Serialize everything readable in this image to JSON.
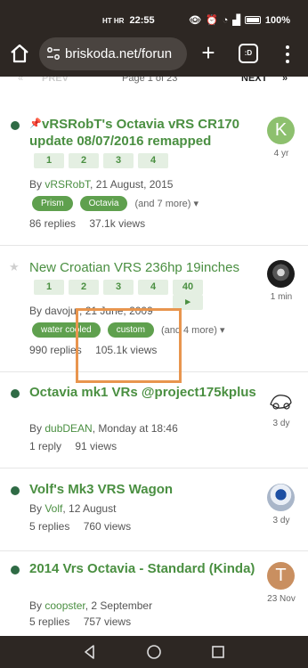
{
  "status_bar": {
    "network": "HT HR",
    "time": "22:55",
    "battery": "100%"
  },
  "browser": {
    "url": "briskoda.net/forun",
    "tabs_count": ":D"
  },
  "pagination": {
    "first": "«",
    "prev": "PREV",
    "page_label": "Page 1 of 23",
    "next": "NEXT",
    "last": "»"
  },
  "threads": [
    {
      "title": "vRSRobT's Octavia vRS CR170 update 08/07/2016 remapped",
      "pages": [
        "1",
        "2",
        "3",
        "4"
      ],
      "by": "By ",
      "author": "vRSRobT",
      "date": ", 21 August, 2015",
      "tags": [
        "Prism",
        "Octavia"
      ],
      "more_tags": "(and 7 more)",
      "replies": "86 replies",
      "views": "37.1k views",
      "avatar_letter": "K",
      "avatar_color": "#8dc06e",
      "age": "4 yr"
    },
    {
      "title": "New Croatian VRS 236hp 19inches",
      "pages": [
        "1",
        "2",
        "3",
        "4",
        "40"
      ],
      "by": "By ",
      "author": "davojur",
      "date": ", 21 June, 2009",
      "tags": [
        "water cooled",
        "custom"
      ],
      "more_tags": "(and 4 more)",
      "replies": "990 replies",
      "views": "105.1k views",
      "age": "1 min"
    },
    {
      "title": "Octavia mk1 VRs @project175kplus",
      "by": "By ",
      "author": "dubDEAN",
      "date": ", Monday at 18:46",
      "replies": "1 reply",
      "views": "91 views",
      "age": "3 dy"
    },
    {
      "title": "Volf's Mk3 VRS Wagon",
      "by": "By ",
      "author": "Volf",
      "date": ", 12 August",
      "replies": "5 replies",
      "views": "760 views",
      "age": "3 dy"
    },
    {
      "title": "2014 Vrs Octavia - Standard (Kinda)",
      "by": "By ",
      "author": "coopster",
      "date": ", 2 September",
      "replies": "5 replies",
      "views": "757 views",
      "avatar_letter": "T",
      "avatar_color": "#c98f60",
      "age": "23 Nov"
    }
  ],
  "colors": {
    "accent": "#4a8f41",
    "tag": "#5fa04e",
    "unread_dot": "#2f6b45",
    "highlight": "#e8954e",
    "chrome": "#2d2723"
  }
}
